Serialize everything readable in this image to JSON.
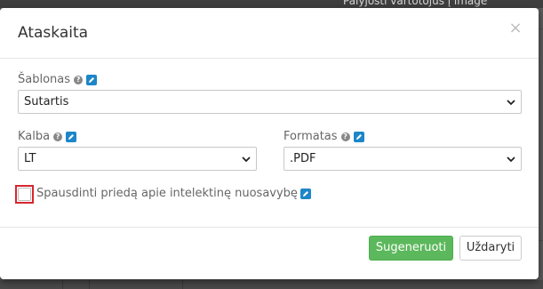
{
  "background": {
    "user_text": "Palyjosti vartotojus į image"
  },
  "modal": {
    "title": "Ataskaita",
    "close_glyph": "×",
    "template": {
      "label": "Šablonas",
      "help_glyph": "?",
      "value": "Sutartis"
    },
    "language": {
      "label": "Kalba",
      "help_glyph": "?",
      "value": "LT"
    },
    "format": {
      "label": "Formatas",
      "help_glyph": "?",
      "value": ".PDF"
    },
    "attachment_checkbox": {
      "label": "Spausdinti priedą apie intelektinę nuosavybę",
      "checked": false
    },
    "footer": {
      "generate_label": "Sugeneruoti",
      "close_label": "Uždaryti"
    }
  },
  "colors": {
    "primary": "#5cb85c",
    "edit_icon": "#1d86c8",
    "highlight": "#d8262e"
  }
}
